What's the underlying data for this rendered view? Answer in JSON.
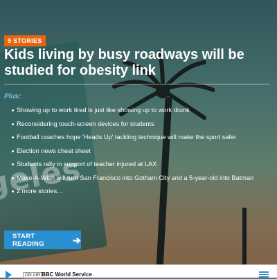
{
  "badge": {
    "label": "9 STORIES"
  },
  "headline": "Kids living by busy roadways will be studied for obesity link",
  "plus_label": "Plus:",
  "stories": [
    "Showing up to work tired is just like showing up to work drunk",
    "Reconsidering touch-screen devices for students",
    "Football coaches hope 'Heads Up' tackling technique will make the sport safer",
    "Election news cheat sheet",
    "Students rally in support of teacher injured at LAX",
    "Make-A-Wish will turn San Francisco into Gotham City and a 5-year-old into Batman",
    "2 more stories..."
  ],
  "cta": {
    "label": "START READING"
  },
  "player": {
    "on_air": "ON AIR",
    "station": "BBC World Service"
  },
  "colors": {
    "accent": "#2a8fd0",
    "badge": "#e8650e",
    "plus": "#7ec3ea"
  }
}
